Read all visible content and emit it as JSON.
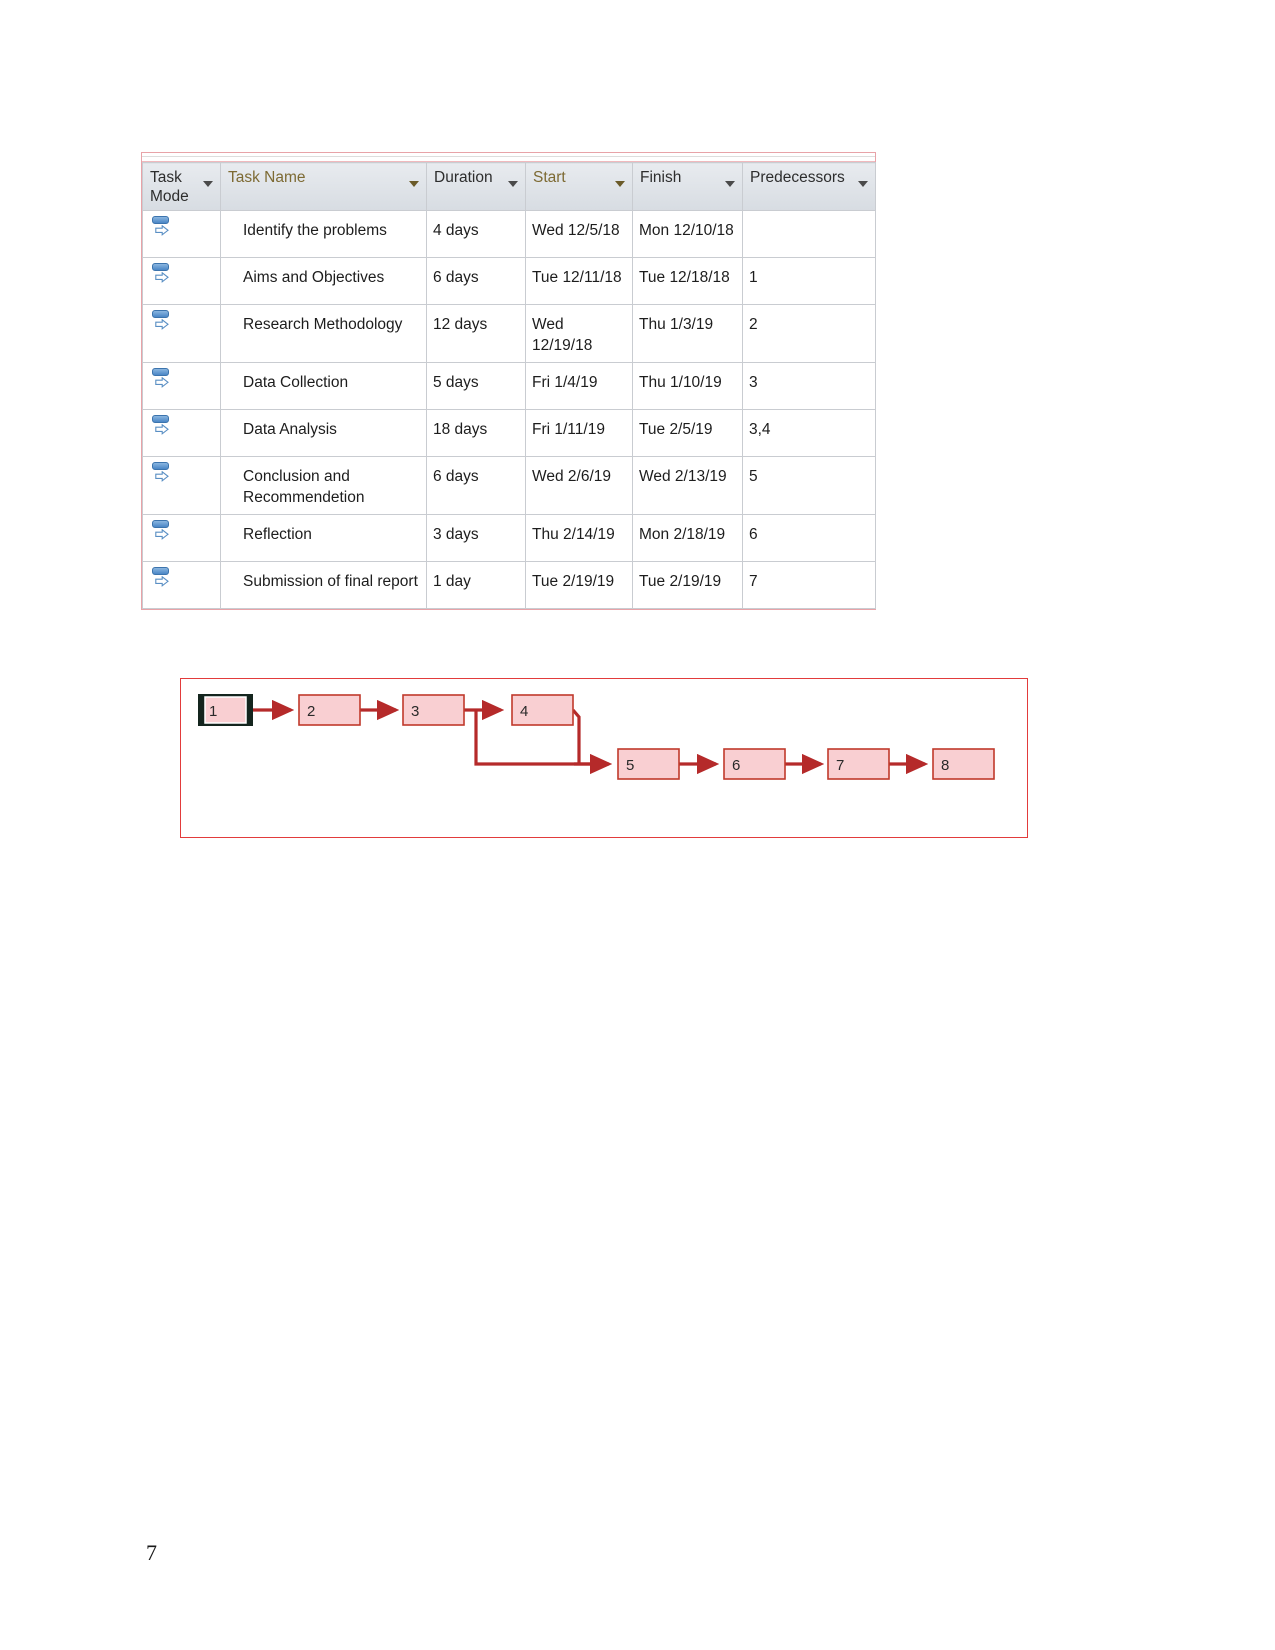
{
  "document": {
    "page_number": "7"
  },
  "task_table": {
    "columns": [
      {
        "key": "mode",
        "label": "Task Mode",
        "highlighted": false
      },
      {
        "key": "name",
        "label": "Task Name",
        "highlighted": true
      },
      {
        "key": "dur",
        "label": "Duration",
        "highlighted": false
      },
      {
        "key": "start",
        "label": "Start",
        "highlighted": true
      },
      {
        "key": "finish",
        "label": "Finish",
        "highlighted": false
      },
      {
        "key": "pred",
        "label": "Predecessors",
        "highlighted": false
      }
    ],
    "accent_header_color": "#fbd96b",
    "plain_header_color": "#dfe3e8",
    "border_color": "#e8a3a8",
    "rows": [
      {
        "id": 1,
        "mode_icon": "auto-schedule-icon",
        "name": "Identify the problems",
        "duration": "4 days",
        "start": "Wed 12/5/18",
        "finish": "Mon 12/10/18",
        "predecessors": ""
      },
      {
        "id": 2,
        "mode_icon": "auto-schedule-icon",
        "name": "Aims and Objectives",
        "duration": "6 days",
        "start": "Tue 12/11/18",
        "finish": "Tue 12/18/18",
        "predecessors": "1"
      },
      {
        "id": 3,
        "mode_icon": "auto-schedule-icon",
        "name": "Research Methodology",
        "duration": "12 days",
        "start": "Wed 12/19/18",
        "finish": "Thu 1/3/19",
        "predecessors": "2"
      },
      {
        "id": 4,
        "mode_icon": "auto-schedule-icon",
        "name": "Data Collection",
        "duration": "5 days",
        "start": "Fri 1/4/19",
        "finish": "Thu 1/10/19",
        "predecessors": "3"
      },
      {
        "id": 5,
        "mode_icon": "auto-schedule-icon",
        "name": "Data Analysis",
        "duration": "18 days",
        "start": "Fri 1/11/19",
        "finish": "Tue 2/5/19",
        "predecessors": "3,4"
      },
      {
        "id": 6,
        "mode_icon": "auto-schedule-icon",
        "name": "Conclusion and Recommendetion",
        "duration": "6 days",
        "start": "Wed 2/6/19",
        "finish": "Wed 2/13/19",
        "predecessors": "5"
      },
      {
        "id": 7,
        "mode_icon": "auto-schedule-icon",
        "name": "Reflection",
        "duration": "3 days",
        "start": "Thu 2/14/19",
        "finish": "Mon 2/18/19",
        "predecessors": "6"
      },
      {
        "id": 8,
        "mode_icon": "auto-schedule-icon",
        "name": "Submission of final report",
        "duration": "1 day",
        "start": "Tue 2/19/19",
        "finish": "Tue 2/19/19",
        "predecessors": "7"
      }
    ]
  },
  "network_diagram": {
    "border_color": "#e23b3b",
    "node_fill": "#f9cfd2",
    "node_border": "#c0392b",
    "link_color": "#b52a2a",
    "selected_node_border": "#14251e",
    "nodes": [
      {
        "id": "1",
        "label": "1",
        "selected": true
      },
      {
        "id": "2",
        "label": "2",
        "selected": false
      },
      {
        "id": "3",
        "label": "3",
        "selected": false
      },
      {
        "id": "4",
        "label": "4",
        "selected": false
      },
      {
        "id": "5",
        "label": "5",
        "selected": false
      },
      {
        "id": "6",
        "label": "6",
        "selected": false
      },
      {
        "id": "7",
        "label": "7",
        "selected": false
      },
      {
        "id": "8",
        "label": "8",
        "selected": false
      }
    ],
    "links": [
      {
        "from": "1",
        "to": "2"
      },
      {
        "from": "2",
        "to": "3"
      },
      {
        "from": "3",
        "to": "4"
      },
      {
        "from": "3",
        "to": "5"
      },
      {
        "from": "4",
        "to": "5"
      },
      {
        "from": "5",
        "to": "6"
      },
      {
        "from": "6",
        "to": "7"
      },
      {
        "from": "7",
        "to": "8"
      }
    ]
  }
}
